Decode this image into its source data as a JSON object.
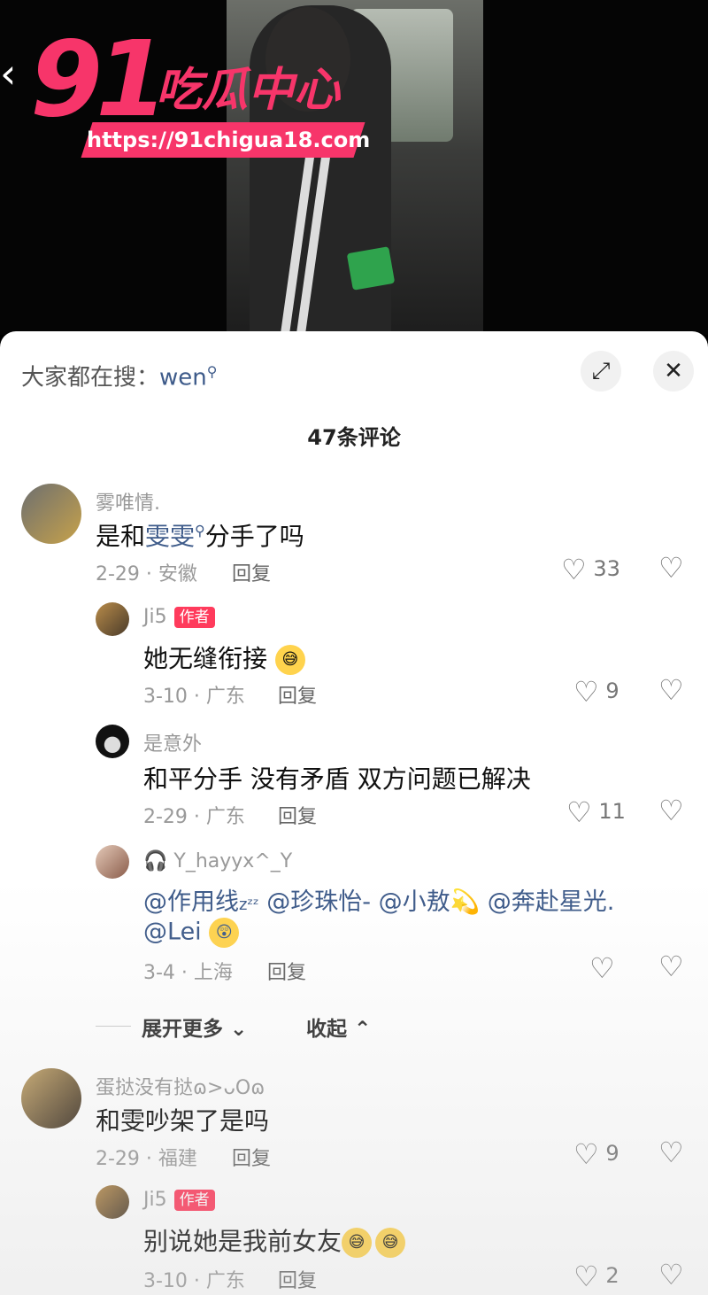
{
  "watermark": {
    "number": "91",
    "name": "吃瓜中心",
    "url": "https://91chigua18.com"
  },
  "nav": {
    "back_icon": "‹"
  },
  "sheet": {
    "search_prefix": "大家都在搜：",
    "search_keyword": "wen",
    "comment_count": "47条评论"
  },
  "comments": [
    {
      "user": "雾唯情.",
      "text_plain": "是和",
      "text_link": "雯雯",
      "text_after": "分手了吗",
      "date": "2-29 · 安徽",
      "reply": "回复",
      "likes": "33"
    },
    {
      "user": "Ji5",
      "badge": "作者",
      "text": "她无缝衔接",
      "date": "3-10 · 广东",
      "reply": "回复",
      "likes": "9"
    },
    {
      "user": "是意外",
      "text": "和平分手 没有矛盾 双方问题已解决",
      "date": "2-29 · 广东",
      "reply": "回复",
      "likes": "11"
    },
    {
      "user": "Y_hayyx^_Y",
      "m1": "@作用线",
      "m1s": "zᶻᶻ",
      "m2": "@珍珠怡-",
      "m3": "@小敖",
      "m4": "@奔赴星光.",
      "m5": "@Lei",
      "date": "3-4 · 上海",
      "reply": "回复",
      "likes": ""
    },
    {
      "user": "蛋挞没有挞ɷ>ᴗOɷ",
      "text": "和雯吵架了是吗",
      "date": "2-29 · 福建",
      "reply": "回复",
      "likes": "9"
    },
    {
      "user": "Ji5",
      "badge": "作者",
      "text": "别说她是我前女友",
      "date": "3-10 · 广东",
      "reply": "回复",
      "likes": "2"
    }
  ],
  "expand": {
    "more": "展开更多",
    "collapse": "收起"
  }
}
